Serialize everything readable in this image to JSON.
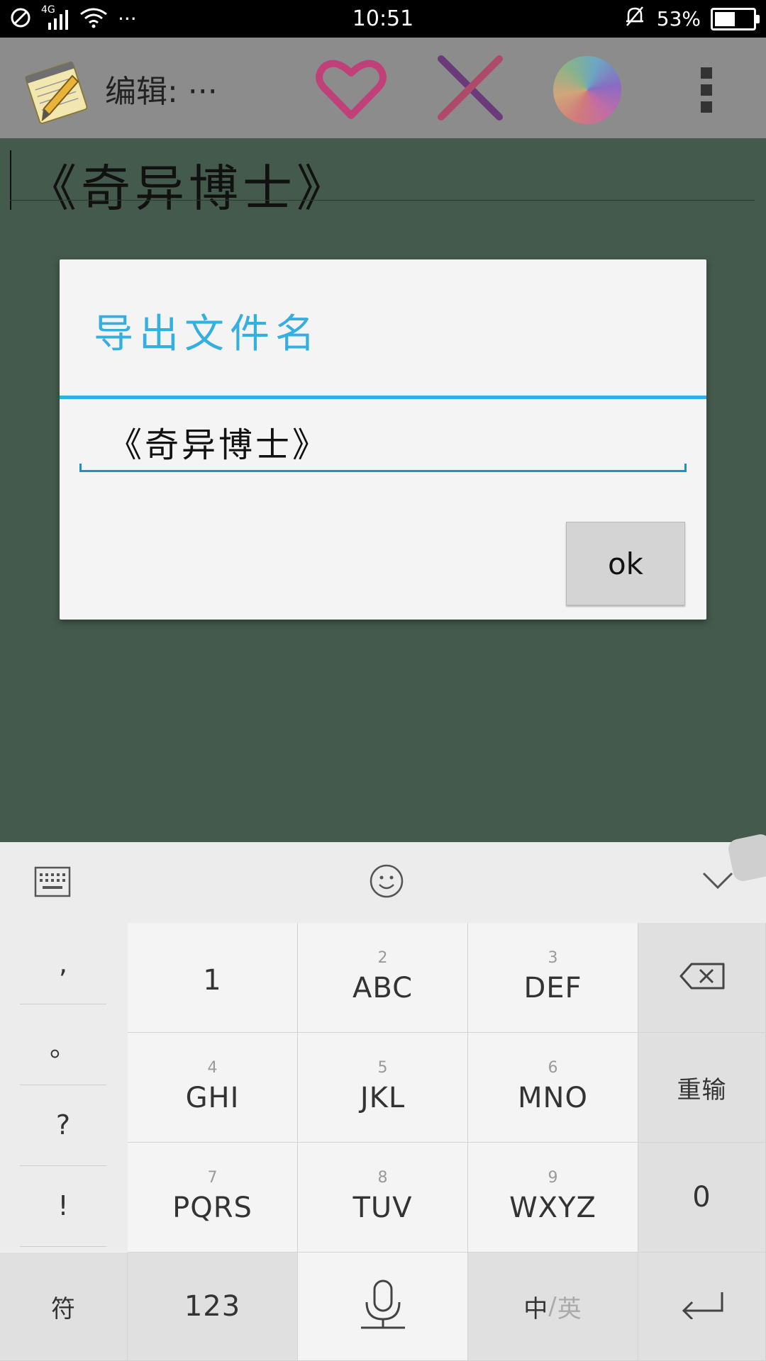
{
  "status_bar": {
    "time": "10:51",
    "network_type": "4G",
    "battery_percent": "53%",
    "battery_level": 0.53,
    "icons": [
      "no-sim-icon",
      "signal-icon",
      "wifi-icon",
      "more-dots-icon",
      "alarm-off-icon",
      "battery-icon"
    ],
    "more_dots": "···"
  },
  "action_bar": {
    "title": "编辑: ···",
    "icons": [
      "notepad-app-icon",
      "heart-icon",
      "close-icon",
      "color-palette-icon",
      "overflow-menu-icon"
    ],
    "colors": {
      "heart": "#c0407a",
      "close": "#6b3a7a",
      "background": "#8c8c8c"
    }
  },
  "editor": {
    "text": "《奇异博士》"
  },
  "dialog": {
    "title": "导出文件名",
    "filename_value": "《奇异博士》",
    "ok_label": "ok",
    "accent_color": "#35aee0"
  },
  "keyboard": {
    "toolbar_icons": [
      "keyboard-icon",
      "emoji-icon",
      "collapse-keyboard-icon"
    ],
    "punctuation": [
      ",",
      "。",
      "?",
      "!"
    ],
    "keys": [
      {
        "num": "",
        "label": "1"
      },
      {
        "num": "2",
        "label": "ABC"
      },
      {
        "num": "3",
        "label": "DEF"
      },
      {
        "num": "",
        "label": "⌫"
      },
      {
        "num": "4",
        "label": "GHI"
      },
      {
        "num": "5",
        "label": "JKL"
      },
      {
        "num": "6",
        "label": "MNO"
      },
      {
        "num": "",
        "label": "重输"
      },
      {
        "num": "7",
        "label": "PQRS"
      },
      {
        "num": "8",
        "label": "TUV"
      },
      {
        "num": "9",
        "label": "WXYZ"
      },
      {
        "num": "",
        "label": "0"
      }
    ],
    "bottom_row": {
      "symbols": "符",
      "numeric": "123",
      "lang_cn": "中",
      "lang_sep": "/",
      "lang_en": "英"
    }
  }
}
